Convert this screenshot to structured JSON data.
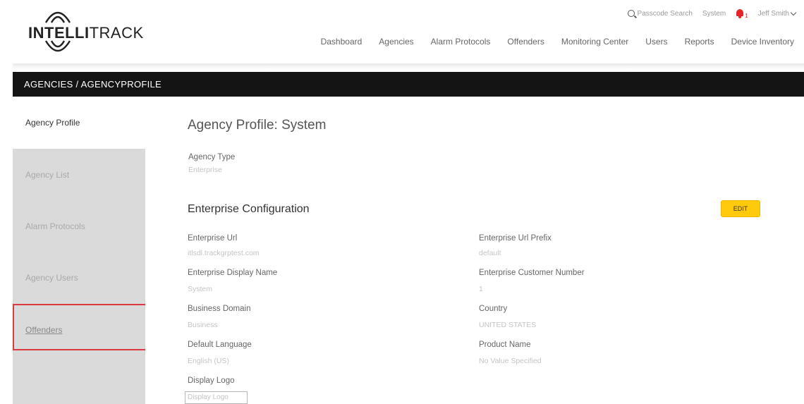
{
  "brand": {
    "logo_bold": "INTELLI",
    "logo_light": "TRACK"
  },
  "utility": {
    "search_label": "Passcode Search",
    "system_label": "System",
    "notification_count": "1",
    "user_name": "Jeff Smith"
  },
  "nav": {
    "items": [
      {
        "label": "Dashboard"
      },
      {
        "label": "Agencies"
      },
      {
        "label": "Alarm Protocols"
      },
      {
        "label": "Offenders"
      },
      {
        "label": "Monitoring Center"
      },
      {
        "label": "Users"
      },
      {
        "label": "Reports"
      },
      {
        "label": "Device Inventory"
      }
    ]
  },
  "breadcrumb": "AGENCIES / AGENCYPROFILE",
  "sidebar": {
    "items": [
      {
        "label": "Agency Profile"
      },
      {
        "label": "Agency List"
      },
      {
        "label": "Alarm Protocols"
      },
      {
        "label": "Agency Users"
      },
      {
        "label": "Offenders"
      }
    ]
  },
  "main": {
    "title": "Agency Profile: System",
    "agency_type_label": "Agency Type",
    "agency_type_value": "Enterprise",
    "section_title": "Enterprise Configuration",
    "edit_label": "EDIT",
    "fields": {
      "enterprise_url_label": "Enterprise Url",
      "enterprise_url_value": "itlsdl.trackgrptest.com",
      "enterprise_url_prefix_label": "Enterprise Url Prefix",
      "enterprise_url_prefix_value": "default",
      "display_name_label": "Enterprise Display Name",
      "display_name_value": "System",
      "customer_number_label": "Enterprise Customer Number",
      "customer_number_value": "1",
      "business_domain_label": "Business Domain",
      "business_domain_value": "Business",
      "country_label": "Country",
      "country_value": "UNITED STATES",
      "default_language_label": "Default Language",
      "default_language_value": "English (US)",
      "product_name_label": "Product Name",
      "product_name_value": "No Value Specified",
      "display_logo_label": "Display Logo",
      "display_logo_value": "Display Logo"
    }
  },
  "colors": {
    "accent_yellow": "#ffca0b",
    "highlight_red": "#d93b3f",
    "breadcrumb_bg": "#141414",
    "sidebar_bg": "#dadada",
    "bell_red": "#e5252a"
  },
  "icons": [
    "intellitrack-logo",
    "search-icon",
    "bell-icon",
    "chevron-down-icon"
  ]
}
